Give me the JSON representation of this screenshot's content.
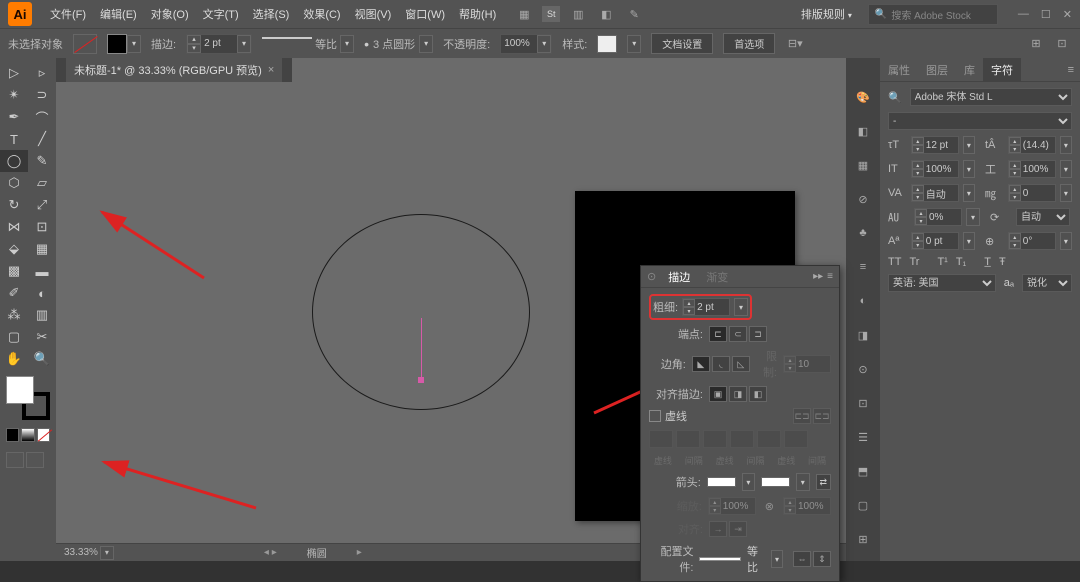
{
  "app": {
    "logo": "Ai"
  },
  "menus": [
    "文件(F)",
    "编辑(E)",
    "对象(O)",
    "文字(T)",
    "选择(S)",
    "效果(C)",
    "视图(V)",
    "窗口(W)",
    "帮助(H)"
  ],
  "topRight": {
    "layoutLabel": "排版规则",
    "searchPlaceholder": "搜索 Adobe Stock"
  },
  "controlBar": {
    "selectionLabel": "未选择对象",
    "strokeLabel": "描边:",
    "strokeWeight": "2 pt",
    "styleLabel": "等比",
    "brushLabel": "3 点圆形",
    "opacityLabel": "不透明度:",
    "opacityValue": "100%",
    "styleLabel2": "样式:",
    "docSetup": "文档设置",
    "prefs": "首选项"
  },
  "tab": {
    "title": "未标题-1* @ 33.33% (RGB/GPU 预览)"
  },
  "status": {
    "zoom": "33.33%",
    "tool": "椭圆"
  },
  "strokePanel": {
    "tabActive": "描边",
    "tabInactive": "渐变",
    "weightLabel": "粗细:",
    "weightValue": "2 pt",
    "capLabel": "端点:",
    "cornerLabel": "边角:",
    "limitLabel": "限制:",
    "limitValue": "10",
    "alignLabel": "对齐描边:",
    "dashLabel": "虚线",
    "dashCols": [
      "虚线",
      "间隔",
      "虚线",
      "间隔",
      "虚线",
      "间隔"
    ],
    "arrowLabel": "箭头:",
    "scaleLabel": "缩放:",
    "scaleValue": "100%",
    "alignArrowLabel": "对齐:",
    "profileLabel": "配置文件:",
    "profileValue": "等比"
  },
  "charPanel": {
    "tabs": [
      "属性",
      "图层",
      "库",
      "字符"
    ],
    "activeTab": 3,
    "font": "Adobe 宋体 Std L",
    "fontStyle": "-",
    "size": "12 pt",
    "leading": "(14.4)",
    "vscale": "100%",
    "hscale": "100%",
    "kerning": "自动",
    "tracking": "0",
    "baselineShift": "0%",
    "rotation": "自动",
    "aki1": "0 pt",
    "aki2": "0°",
    "lang": "英语: 美国",
    "aa": "锐化"
  }
}
